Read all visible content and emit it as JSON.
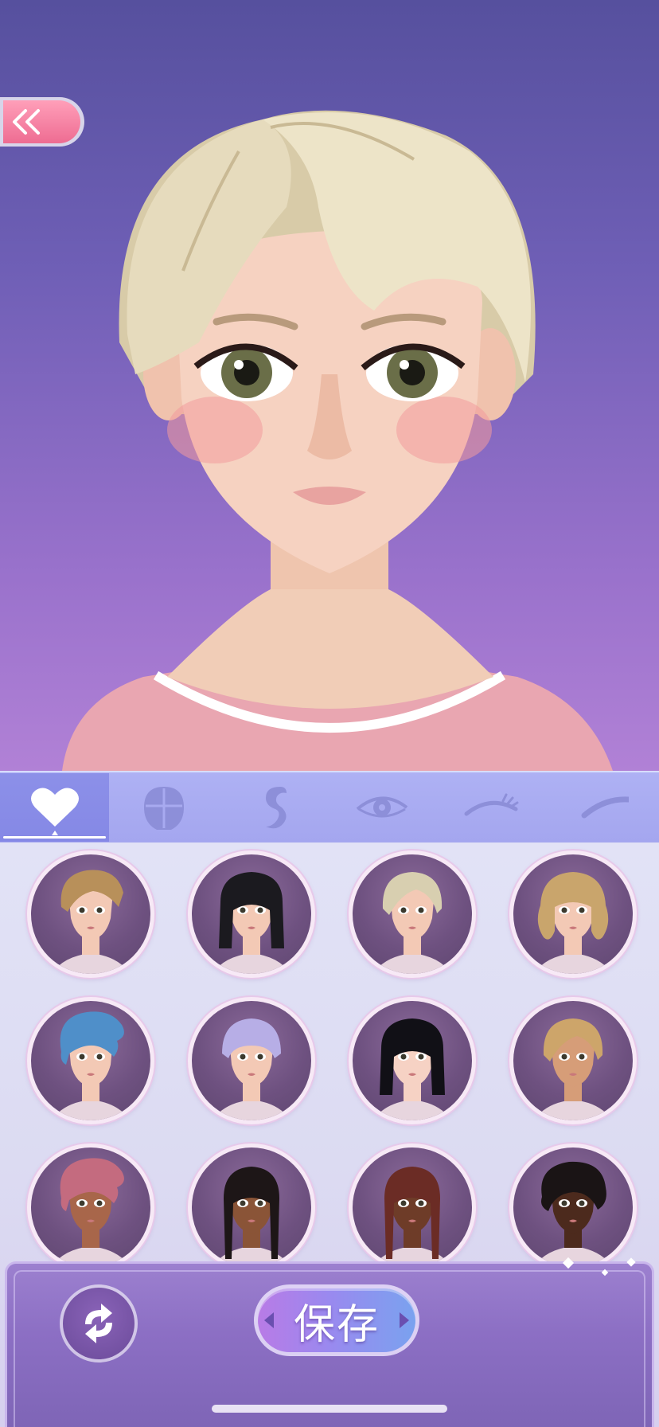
{
  "header": {
    "back_icon": "double-chevron-left-icon"
  },
  "tabs": [
    {
      "id": "favorites",
      "icon": "heart-icon",
      "active": true
    },
    {
      "id": "face",
      "icon": "head-outline-icon",
      "active": false
    },
    {
      "id": "hair",
      "icon": "hair-strand-icon",
      "active": false
    },
    {
      "id": "eyes",
      "icon": "eye-icon",
      "active": false
    },
    {
      "id": "eyelashes",
      "icon": "eyelash-icon",
      "active": false
    },
    {
      "id": "eyebrows",
      "icon": "eyebrow-icon",
      "active": false
    }
  ],
  "hair_options": [
    {
      "hair": "#b8905a",
      "skin": "#f3c9b5",
      "style": "short-swept"
    },
    {
      "hair": "#1b1a1f",
      "skin": "#f3c9b5",
      "style": "bob-bangs"
    },
    {
      "hair": "#d8cfb0",
      "skin": "#f3c9b5",
      "style": "short-side"
    },
    {
      "hair": "#c9a56c",
      "skin": "#f3c9b5",
      "style": "wavy-bob"
    },
    {
      "hair": "#4f8fc9",
      "skin": "#f3c9b5",
      "style": "pompadour"
    },
    {
      "hair": "#b7aee6",
      "skin": "#f3c9b5",
      "style": "bangs-short"
    },
    {
      "hair": "#111016",
      "skin": "#f6d2c4",
      "style": "bob-bangs"
    },
    {
      "hair": "#cda56a",
      "skin": "#d69d78",
      "style": "short-side"
    },
    {
      "hair": "#c46b7f",
      "skin": "#a8664a",
      "style": "pompadour"
    },
    {
      "hair": "#1d1617",
      "skin": "#8a5437",
      "style": "braids"
    },
    {
      "hair": "#6b2c25",
      "skin": "#6e3c28",
      "style": "braids"
    },
    {
      "hair": "#1a1415",
      "skin": "#4c2a1d",
      "style": "curly-updo"
    }
  ],
  "footer": {
    "reset_icon": "refresh-arrows-icon",
    "save_label": "保存"
  },
  "colors": {
    "accent_pink": "#ee6c92",
    "tab_bar": "#a4a6ef",
    "panel_bg": "#dcdbf2"
  }
}
